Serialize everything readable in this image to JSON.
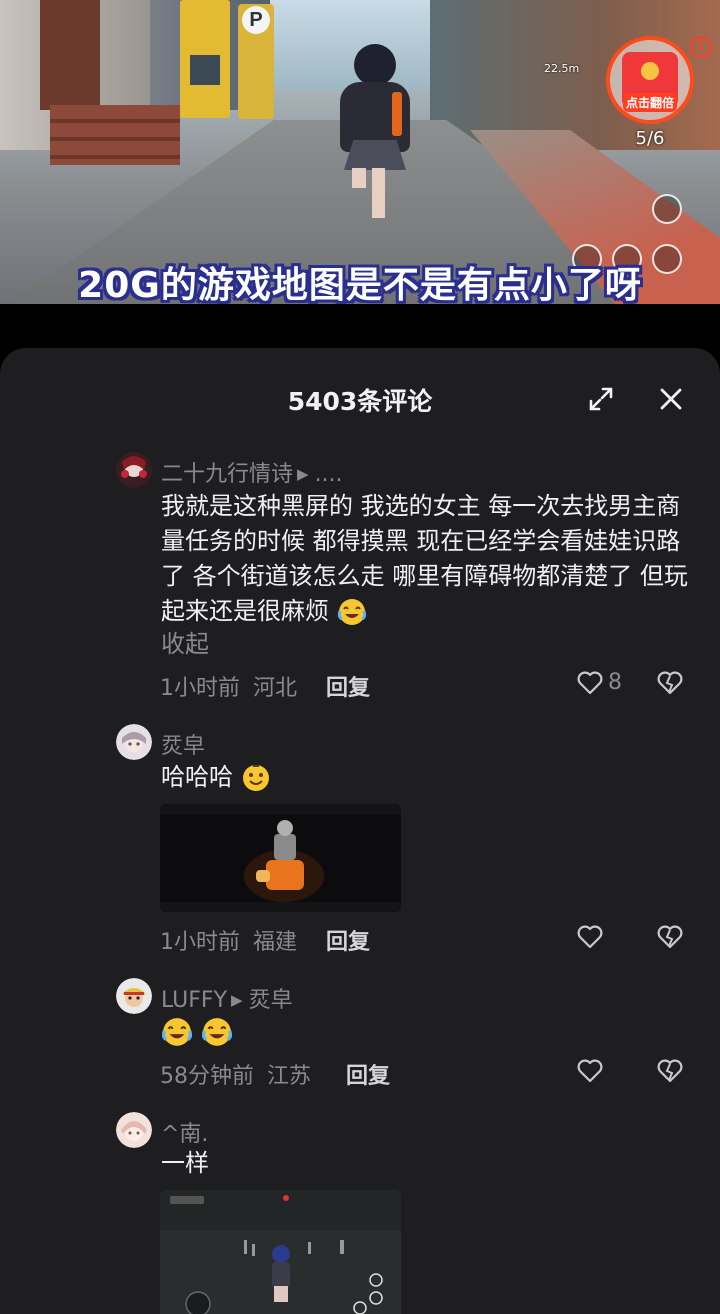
{
  "video": {
    "caption": "20G的游戏地图是不是有点小了呀",
    "hud_distance": "22.5m",
    "redpacket_label": "点击翻倍",
    "redpacket_counter": "5/6",
    "ptower_letter": "P"
  },
  "sheet": {
    "title": "5403条评论"
  },
  "comments": [
    {
      "username": "二十九行情诗",
      "reply_to": "....",
      "text": "我就是这种黑屏的 我选的女主 每一次去找男主商量任务的时候 都得摸黑 现在已经学会看娃娃识路了 各个街道该怎么走 哪里有障碍物都清楚了 但玩起来还是很麻烦",
      "collapse_label": "收起",
      "time": "1小时前",
      "location": "河北",
      "reply_label": "回复",
      "likes": "8"
    },
    {
      "username": "烎皁",
      "text": "哈哈哈",
      "time": "1小时前",
      "location": "福建",
      "reply_label": "回复"
    },
    {
      "username": "LUFFY",
      "reply_to": "烎皁",
      "time": "58分钟前",
      "location": "江苏",
      "reply_label": "回复"
    },
    {
      "username": "^南.",
      "text": "一样"
    }
  ]
}
